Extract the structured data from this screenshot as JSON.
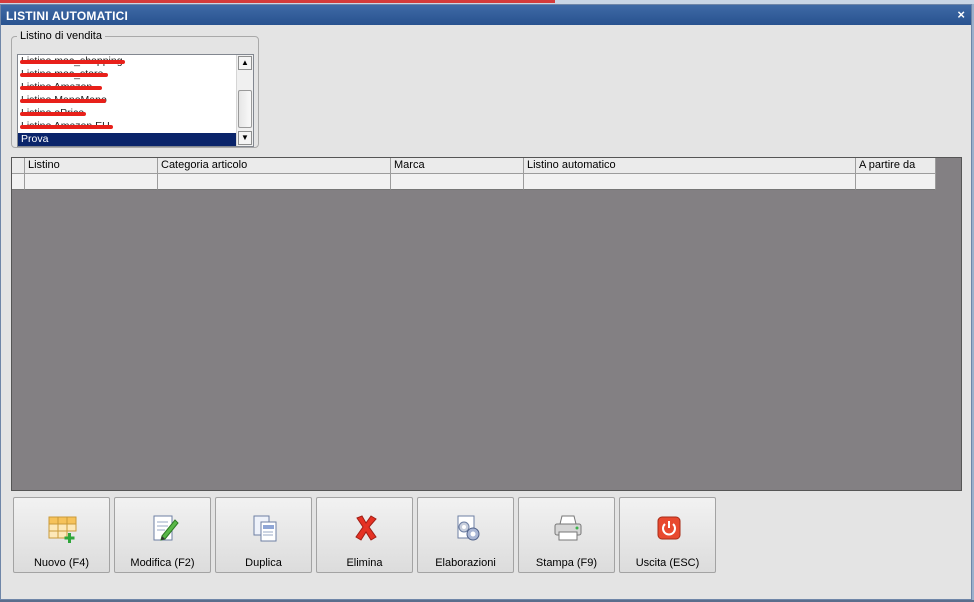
{
  "window": {
    "title": "LISTINI AUTOMATICI",
    "close_label": "×"
  },
  "listino_vendita": {
    "legend": "Listino di vendita",
    "items": [
      {
        "label": "Listino moc_shopping",
        "redacted": true
      },
      {
        "label": "Listino moc_store",
        "redacted": true
      },
      {
        "label": "Listino Amazon",
        "redacted": true
      },
      {
        "label": "Listino ManoMano",
        "redacted": true
      },
      {
        "label": "Listino ePrice",
        "redacted": true
      },
      {
        "label": "Listino Amazon EU",
        "redacted": true
      },
      {
        "label": "Prova",
        "redacted": false,
        "selected": true
      }
    ]
  },
  "grid": {
    "columns": [
      "",
      "Listino",
      "Categoria articolo",
      "Marca",
      "Listino automatico",
      "A partire da"
    ],
    "rows": [
      [
        "",
        "",
        "",
        "",
        "",
        ""
      ]
    ]
  },
  "toolbar": {
    "buttons": [
      {
        "name": "nuovo",
        "label": "Nuovo (F4)",
        "icon": "grid-add-icon"
      },
      {
        "name": "modifica",
        "label": "Modifica (F2)",
        "icon": "edit-document-icon"
      },
      {
        "name": "duplica",
        "label": "Duplica",
        "icon": "duplicate-icon"
      },
      {
        "name": "elimina",
        "label": "Elimina",
        "icon": "delete-x-icon"
      },
      {
        "name": "elaborazioni",
        "label": "Elaborazioni",
        "icon": "gear-document-icon"
      },
      {
        "name": "stampa",
        "label": "Stampa (F9)",
        "icon": "printer-icon"
      },
      {
        "name": "uscita",
        "label": "Uscita (ESC)",
        "icon": "power-icon"
      }
    ]
  },
  "colors": {
    "titlebar": "#2d5896",
    "grid_background": "#838083",
    "selection": "#0a246a",
    "redaction": "#e8201a"
  }
}
